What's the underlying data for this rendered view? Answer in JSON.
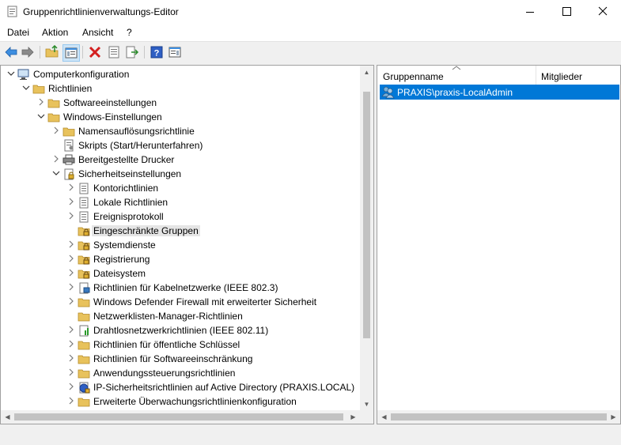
{
  "window": {
    "title": "Gruppenrichtlinienverwaltungs-Editor"
  },
  "menu": [
    "Datei",
    "Aktion",
    "Ansicht",
    "?"
  ],
  "tree": [
    {
      "label": "Computerkonfiguration",
      "expander": "down",
      "icon": "computer-icon"
    },
    {
      "label": "Richtlinien",
      "expander": "down",
      "icon": "folder-icon"
    },
    {
      "label": "Softwareeinstellungen",
      "expander": "right",
      "icon": "folder-icon"
    },
    {
      "label": "Windows-Einstellungen",
      "expander": "down",
      "icon": "folder-icon"
    },
    {
      "label": "Namensauflösungsrichtlinie",
      "expander": "right",
      "icon": "folder-icon"
    },
    {
      "label": "Skripts (Start/Herunterfahren)",
      "expander": "",
      "icon": "script-icon"
    },
    {
      "label": "Bereitgestellte Drucker",
      "expander": "right",
      "icon": "printer-icon"
    },
    {
      "label": "Sicherheitseinstellungen",
      "expander": "down",
      "icon": "security-icon"
    },
    {
      "label": "Kontorichtlinien",
      "expander": "right",
      "icon": "policy-icon"
    },
    {
      "label": "Lokale Richtlinien",
      "expander": "right",
      "icon": "policy-icon"
    },
    {
      "label": "Ereignisprotokoll",
      "expander": "right",
      "icon": "policy-icon"
    },
    {
      "label": "Eingeschränkte Gruppen",
      "expander": "",
      "icon": "locked-folder-icon",
      "selected": true
    },
    {
      "label": "Systemdienste",
      "expander": "right",
      "icon": "locked-folder-icon"
    },
    {
      "label": "Registrierung",
      "expander": "right",
      "icon": "locked-folder-icon"
    },
    {
      "label": "Dateisystem",
      "expander": "right",
      "icon": "locked-folder-icon"
    },
    {
      "label": "Richtlinien für Kabelnetzwerke (IEEE 802.3)",
      "expander": "right",
      "icon": "network-policy-icon"
    },
    {
      "label": "Windows Defender Firewall mit erweiterter Sicherheit",
      "expander": "right",
      "icon": "folder-icon"
    },
    {
      "label": "Netzwerklisten-Manager-Richtlinien",
      "expander": "",
      "icon": "folder-icon"
    },
    {
      "label": "Drahtlosnetzwerkrichtlinien (IEEE 802.11)",
      "expander": "right",
      "icon": "wireless-policy-icon"
    },
    {
      "label": "Richtlinien für öffentliche Schlüssel",
      "expander": "right",
      "icon": "folder-icon"
    },
    {
      "label": "Richtlinien für Softwareeinschränkung",
      "expander": "right",
      "icon": "folder-icon"
    },
    {
      "label": "Anwendungssteuerungsrichtlinien",
      "expander": "right",
      "icon": "folder-icon"
    },
    {
      "label": "IP-Sicherheitsrichtlinien auf Active Directory (PRAXIS.LOCAL)",
      "expander": "right",
      "icon": "ip-security-icon"
    },
    {
      "label": "Erweiterte Überwachungsrichtlinienkonfiguration",
      "expander": "right",
      "icon": "folder-icon"
    }
  ],
  "list": {
    "columns": [
      "Gruppenname",
      "Mitglieder"
    ],
    "rows": [
      {
        "name": "PRAXIS\\praxis-LocalAdmin",
        "members": ""
      }
    ]
  },
  "colors": {
    "selection": "#0078d7",
    "folder": "#e8c25c"
  }
}
